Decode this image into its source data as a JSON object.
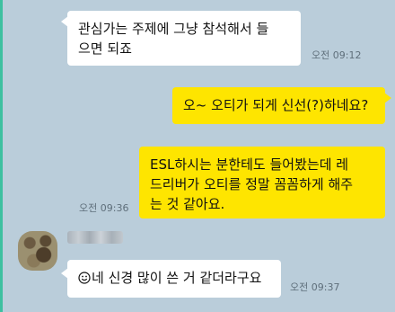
{
  "messages": [
    {
      "lines": [
        "관심가는 주제에 그냥 참석해서 들",
        "으면 되죠"
      ],
      "time": "오전 09:12"
    },
    {
      "lines": [
        "오~ 오티가 되게 신선(?)하네요?"
      ]
    },
    {
      "lines": [
        "ESL하시는 분한테도 들어봤는데 레",
        "드리버가 오티를 정말 꼼꼼하게 해주",
        "는 것 같아요."
      ],
      "time": "오전 09:36"
    },
    {
      "lines": [
        "네 신경 많이 쓴 거 같더라구요"
      ],
      "emoji": "smiley-icon",
      "time": "오전 09:37"
    }
  ],
  "colors": {
    "background": "#bacdda",
    "my_bubble": "#fee500",
    "their_bubble": "#ffffff"
  }
}
